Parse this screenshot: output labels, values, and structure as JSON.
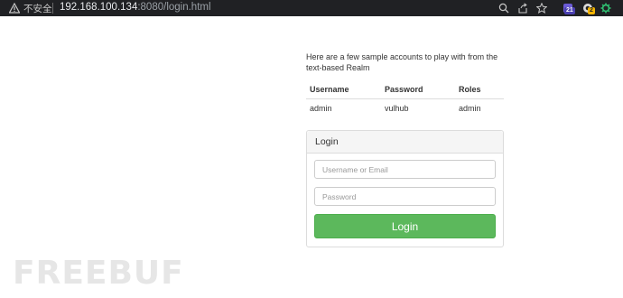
{
  "browser": {
    "security_label": "不安全",
    "url_host": "192.168.100.134",
    "url_rest": ":8080/login.html",
    "extension_badge_1": "21",
    "extension_badge_2": "2"
  },
  "accounts": {
    "intro": "Here are a few sample accounts to play with from the text-based Realm",
    "columns": [
      "Username",
      "Password",
      "Roles"
    ],
    "rows": [
      [
        "admin",
        "vulhub",
        "admin"
      ]
    ]
  },
  "login": {
    "heading": "Login",
    "username_placeholder": "Username or Email",
    "password_placeholder": "Password",
    "submit_label": "Login"
  },
  "watermark": {
    "text": "FREEBUF"
  },
  "colors": {
    "topbar": "#202124",
    "login_button": "#5cb85c",
    "panel_heading_bg": "#f5f5f5"
  }
}
